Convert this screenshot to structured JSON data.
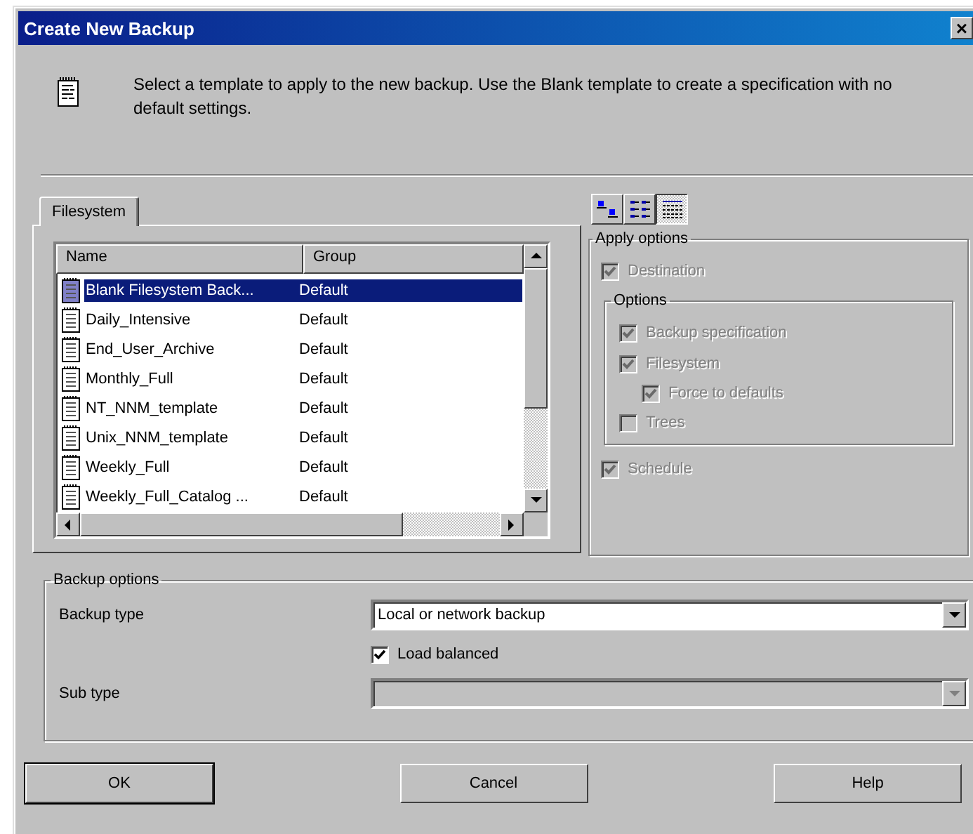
{
  "window": {
    "title": "Create New Backup",
    "close": "×"
  },
  "intro": "Select a template to apply to the new backup. Use the Blank template to create a specification with no default settings.",
  "tabs": [
    {
      "label": "Filesystem",
      "selected": true
    }
  ],
  "template_list": {
    "columns": [
      "Name",
      "Group"
    ],
    "rows": [
      {
        "name": "Blank Filesystem Back...",
        "group": "Default",
        "selected": true
      },
      {
        "name": "Daily_Intensive",
        "group": "Default",
        "selected": false
      },
      {
        "name": "End_User_Archive",
        "group": "Default",
        "selected": false
      },
      {
        "name": "Monthly_Full",
        "group": "Default",
        "selected": false
      },
      {
        "name": "NT_NNM_template",
        "group": "Default",
        "selected": false
      },
      {
        "name": "Unix_NNM_template",
        "group": "Default",
        "selected": false
      },
      {
        "name": "Weekly_Full",
        "group": "Default",
        "selected": false
      },
      {
        "name": "Weekly_Full_Catalog ...",
        "group": "Default",
        "selected": false
      }
    ]
  },
  "view_buttons": [
    {
      "kind": "large",
      "selected": false
    },
    {
      "kind": "list",
      "selected": false
    },
    {
      "kind": "details",
      "selected": true
    }
  ],
  "apply_options": {
    "title": "Apply options",
    "items": [
      {
        "kind": "checkbox",
        "label": "Destination",
        "checked": true,
        "disabled": true
      },
      {
        "kind": "group",
        "title": "Options",
        "items": [
          {
            "label": "Backup specification",
            "checked": true,
            "disabled": true
          },
          {
            "label": "Filesystem",
            "checked": true,
            "disabled": true,
            "children": [
              {
                "label": "Force to defaults",
                "checked": true,
                "disabled": true
              }
            ]
          },
          {
            "label": "Trees",
            "checked": false,
            "disabled": true
          }
        ]
      },
      {
        "kind": "checkbox",
        "label": "Schedule",
        "checked": true,
        "disabled": true
      }
    ]
  },
  "backup_options": {
    "title": "Backup options",
    "backup_type": {
      "label": "Backup type",
      "value": "Local or network backup",
      "disabled": false
    },
    "load_balanced": {
      "label": "Load balanced",
      "checked": true,
      "disabled": false
    },
    "sub_type": {
      "label": "Sub type",
      "disabled": true
    }
  },
  "buttons": [
    "OK",
    "Cancel",
    "Help"
  ]
}
